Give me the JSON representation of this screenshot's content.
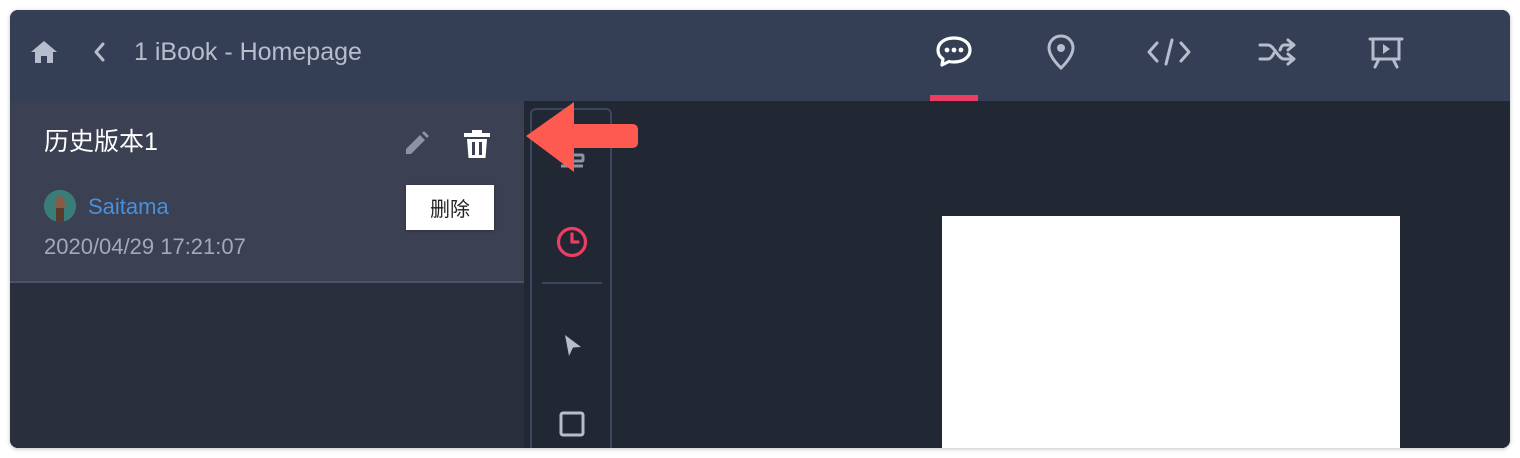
{
  "header": {
    "title": "1 iBook - Homepage",
    "icons": {
      "home": "home-icon",
      "back": "chevron-left-icon"
    },
    "tabs": [
      {
        "name": "comments",
        "icon": "comment-icon",
        "active": true
      },
      {
        "name": "location",
        "icon": "location-pin-icon",
        "active": false
      },
      {
        "name": "code",
        "icon": "code-icon",
        "active": false
      },
      {
        "name": "shuffle",
        "icon": "shuffle-icon",
        "active": false
      },
      {
        "name": "preview",
        "icon": "presentation-icon",
        "active": false
      }
    ]
  },
  "version_panel": {
    "item": {
      "name": "历史版本1",
      "author": "Saitama",
      "timestamp": "2020/04/29 17:21:07"
    },
    "tooltip": "删除"
  },
  "toolbar": {
    "tools": [
      "layers-icon",
      "history-icon",
      "pointer-icon",
      "rectangle-icon"
    ]
  },
  "colors": {
    "header_bg": "#343f55",
    "accent": "#ee3d63",
    "author_link": "#4a90d9",
    "annotation_arrow": "#ff5a4f"
  }
}
